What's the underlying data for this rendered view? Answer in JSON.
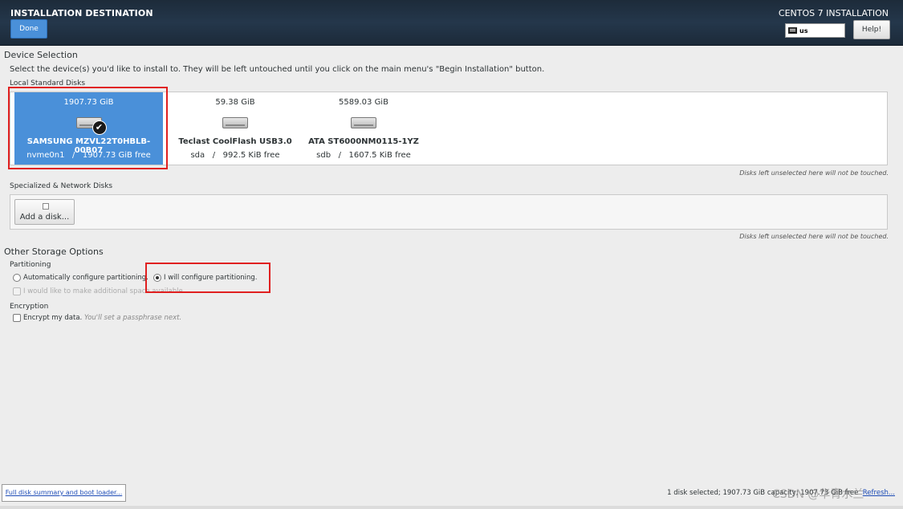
{
  "header": {
    "title": "INSTALLATION DESTINATION",
    "product": "CENTOS 7 INSTALLATION",
    "done_label": "Done",
    "keyboard_layout": "us",
    "help_label": "Help!"
  },
  "device_selection": {
    "heading": "Device Selection",
    "instructions": "Select the device(s) you'd like to install to.  They will be left untouched until you click on the main menu's \"Begin Installation\" button.",
    "local_heading": "Local Standard Disks",
    "disks": [
      {
        "size": "1907.73 GiB",
        "name": "SAMSUNG MZVL22T0HBLB-00B07",
        "device": "nvme0n1",
        "sep": "/",
        "free": "1907.73 GiB free",
        "selected": true
      },
      {
        "size": "59.38 GiB",
        "name": "Teclast CoolFlash USB3.0",
        "device": "sda",
        "sep": "/",
        "free": "992.5 KiB free",
        "selected": false
      },
      {
        "size": "5589.03 GiB",
        "name": "ATA ST6000NM0115-1YZ",
        "device": "sdb",
        "sep": "/",
        "free": "1607.5 KiB free",
        "selected": false
      }
    ],
    "untouched_note": "Disks left unselected here will not be touched.",
    "specialized_heading": "Specialized & Network Disks",
    "add_disk_label": "Add a disk...",
    "untouched_note_2": "Disks left unselected here will not be touched."
  },
  "other_storage": {
    "heading": "Other Storage Options",
    "partitioning_heading": "Partitioning",
    "auto_label": "Automatically configure partitioning.",
    "manual_label": "I will configure partitioning.",
    "additional_space_label": "I would like to make additional space available.",
    "encryption_heading": "Encryption",
    "encrypt_label": "Encrypt my data.",
    "encrypt_hint": "You'll set a passphrase next."
  },
  "footer": {
    "summary_label": "Full disk summary and boot loader...",
    "status_text": "1 disk selected; 1907.73 GiB capacity; 1907.73 GiB free",
    "refresh_label": "Refresh...",
    "watermark": "CSDN @华青水兰"
  },
  "colors": {
    "header_bg": "#1d2b3a",
    "accent": "#4a90d9",
    "highlight": "#e02020"
  }
}
